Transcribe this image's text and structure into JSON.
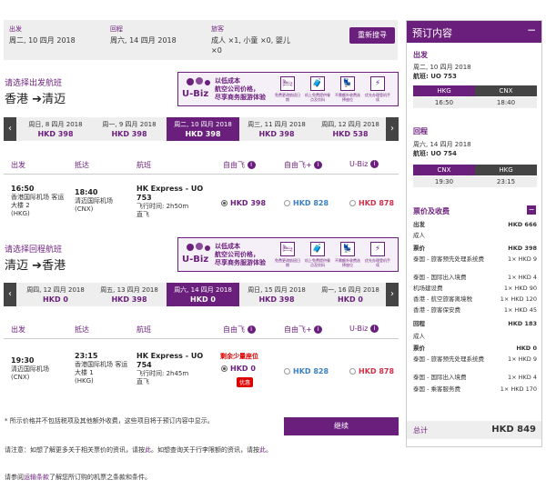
{
  "search": {
    "depart_label": "出发",
    "depart_value": "周二, 10 四月 2018",
    "return_label": "回程",
    "return_value": "周六, 14 四月 2018",
    "pax_label": "旅客",
    "pax_value": "成人 ×1, 小童 ×0, 婴儿 ×0",
    "research_btn": "重新搜寻"
  },
  "banner": {
    "ubiz": "U-Biz",
    "line1": "以低成本",
    "line2": "航空公司价格，",
    "line3": "尽享商务服游体验",
    "icons": [
      {
        "icon": "bed-icon",
        "glyph": "🛏",
        "caption": "免费更改航班日期"
      },
      {
        "icon": "luggage-icon",
        "glyph": "🧳",
        "caption": "机上免费提供餐点及饮料"
      },
      {
        "icon": "seat-icon",
        "glyph": "💺",
        "caption": "不需额外收费选择座位"
      },
      {
        "icon": "priority-icon",
        "glyph": "⚡",
        "caption": "优先办理登机手续"
      }
    ]
  },
  "outbound": {
    "label": "请选择出发航班",
    "route_from": "香港",
    "route_arrow": "➔",
    "route_to": "清迈",
    "dates": [
      {
        "day": "周日, 8 四月 2018",
        "price": "HKD 398"
      },
      {
        "day": "周一, 9 四月 2018",
        "price": "HKD 398"
      },
      {
        "day": "周二, 10 四月 2018",
        "price": "HKD 398"
      },
      {
        "day": "周三, 11 四月 2018",
        "price": "HKD 398"
      },
      {
        "day": "周四, 12 四月 2018",
        "price": "HKD 538"
      }
    ],
    "headers": {
      "depart": "出发",
      "arrive": "抵达",
      "flight": "航班",
      "fare1": "自由飞",
      "fare2": "自由飞+",
      "fare3": "U-Biz"
    },
    "flight": {
      "dep_time": "16:50",
      "dep_airport": "香港国际机场 客运大楼 2",
      "dep_code": "(HKG)",
      "arr_time": "18:40",
      "arr_airport": "清迈国际机场",
      "arr_code": "(CNX)",
      "flight_name": "HK Express - UO 753",
      "duration": "飞行时间: 2h50m",
      "type": "直飞",
      "price1": "HKD 398",
      "price2": "HKD 828",
      "price3": "HKD 878"
    }
  },
  "inbound": {
    "label": "请选择回程航班",
    "route_from": "清迈",
    "route_arrow": "➔",
    "route_to": "香港",
    "dates": [
      {
        "day": "周四, 12 四月 2018",
        "price": "HKD 0"
      },
      {
        "day": "周五, 13 四月 2018",
        "price": "HKD 398"
      },
      {
        "day": "周六, 14 四月 2018",
        "price": "HKD 0"
      },
      {
        "day": "周日, 15 四月 2018",
        "price": "HKD 398"
      },
      {
        "day": "周一, 16 四月 2018",
        "price": "HKD 0"
      }
    ],
    "headers": {
      "depart": "出发",
      "arrive": "抵达",
      "flight": "航班",
      "fare1": "自由飞",
      "fare2": "自由飞+",
      "fare3": "U-Biz"
    },
    "flight": {
      "dep_time": "19:30",
      "dep_airport": "清迈国际机场",
      "dep_code": "(CNX)",
      "arr_time": "23:15",
      "arr_airport": "香港国际机场 客运大楼 1",
      "arr_code": "(HKG)",
      "flight_name": "HK Express - UO 754",
      "duration": "飞行时间: 2h45m",
      "type": "直飞",
      "seats_left": "剩余少量座位",
      "price1": "HKD 0",
      "price2": "HKD 828",
      "price3": "HKD 878",
      "sale_badge": "优惠"
    }
  },
  "notes": {
    "n1": "* 所示价格并不包括税项及其他额外收费，这些项目将于预订内容中显示。",
    "n2a": "请注意：如想了解更多关于相关票价的资讯，请按",
    "n2link": "此",
    "n2b": "。如想查询关于行李限额的资讯，请按",
    "n2link2": "此",
    "n2c": "。",
    "n3a": "请参阅",
    "n3link": "运输条款",
    "n3b": "了解您所订购的机票之条款和条件。",
    "continue_btn": "继续"
  },
  "panel": {
    "title": "预订内容",
    "minus": "−",
    "out_label": "出发",
    "out_date": "周二, 10 四月 2018",
    "out_flight": "航班: UO 753",
    "out_from": "HKG",
    "out_to": "CNX",
    "out_dep": "16:50",
    "out_arr": "18:40",
    "ret_label": "回程",
    "ret_date": "周六, 14 四月 2018",
    "ret_flight": "航班: UO 754",
    "ret_from": "CNX",
    "ret_to": "HKG",
    "ret_dep": "19:30",
    "ret_arr": "23:15",
    "fees_label": "票价及收费",
    "rows": [
      {
        "l": "出发",
        "r": "HKD 666",
        "bold": true
      },
      {
        "l": "成人",
        "r": ""
      },
      {
        "l": "票价",
        "r": "HKD 398",
        "bold": true
      },
      {
        "l": "泰国 - 旅客预先处理系统费",
        "r": "1× HKD 9"
      },
      {
        "l": "泰国 - 国际出入境费",
        "r": "1× HKD 4"
      },
      {
        "l": "机场建设费",
        "r": "1× HKD 90"
      },
      {
        "l": "香港 - 航空旅客离境税",
        "r": "1× HKD 120"
      },
      {
        "l": "香港 - 旅客保安费",
        "r": "1× HKD 45"
      },
      {
        "l": "回程",
        "r": "HKD 183",
        "bold": true
      },
      {
        "l": "成人",
        "r": ""
      },
      {
        "l": "票价",
        "r": "HKD 0",
        "bold": true
      },
      {
        "l": "泰国 - 旅客预先处理系统费",
        "r": "1× HKD 9"
      },
      {
        "l": "泰国 - 国际出入境费",
        "r": "1× HKD 4"
      },
      {
        "l": "泰国 - 乘客服务费",
        "r": "1× HKD 170"
      }
    ],
    "total_label": "总计",
    "total_value": "HKD 849"
  }
}
